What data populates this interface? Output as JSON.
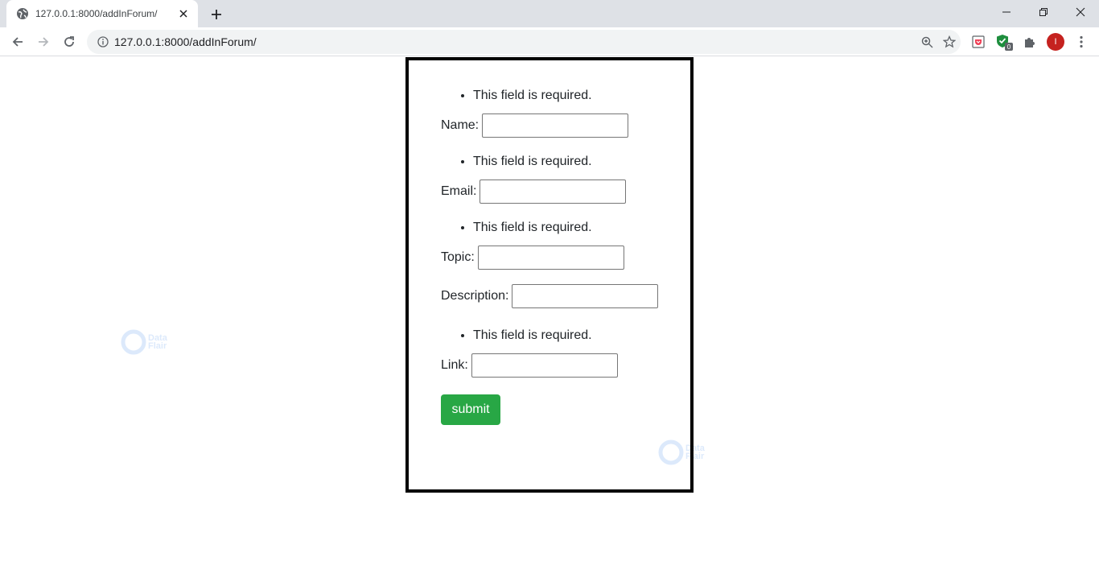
{
  "browser": {
    "tab_title": "127.0.0.1:8000/addInForum/",
    "url": "127.0.0.1:8000/addInForum/",
    "extension_badge": "0",
    "avatar_initial": "I"
  },
  "form": {
    "error_message": "This field is required.",
    "name_label": "Name:",
    "email_label": "Email:",
    "topic_label": "Topic:",
    "description_label": "Description:",
    "link_label": "Link:",
    "name_value": "",
    "email_value": "",
    "topic_value": "",
    "description_value": "",
    "link_value": "",
    "submit_label": "submit"
  },
  "watermark": {
    "line1": "Data",
    "line2": "Flair"
  },
  "colors": {
    "submit_bg": "#28a745",
    "avatar_bg": "#c5221f",
    "form_border": "#000000"
  }
}
